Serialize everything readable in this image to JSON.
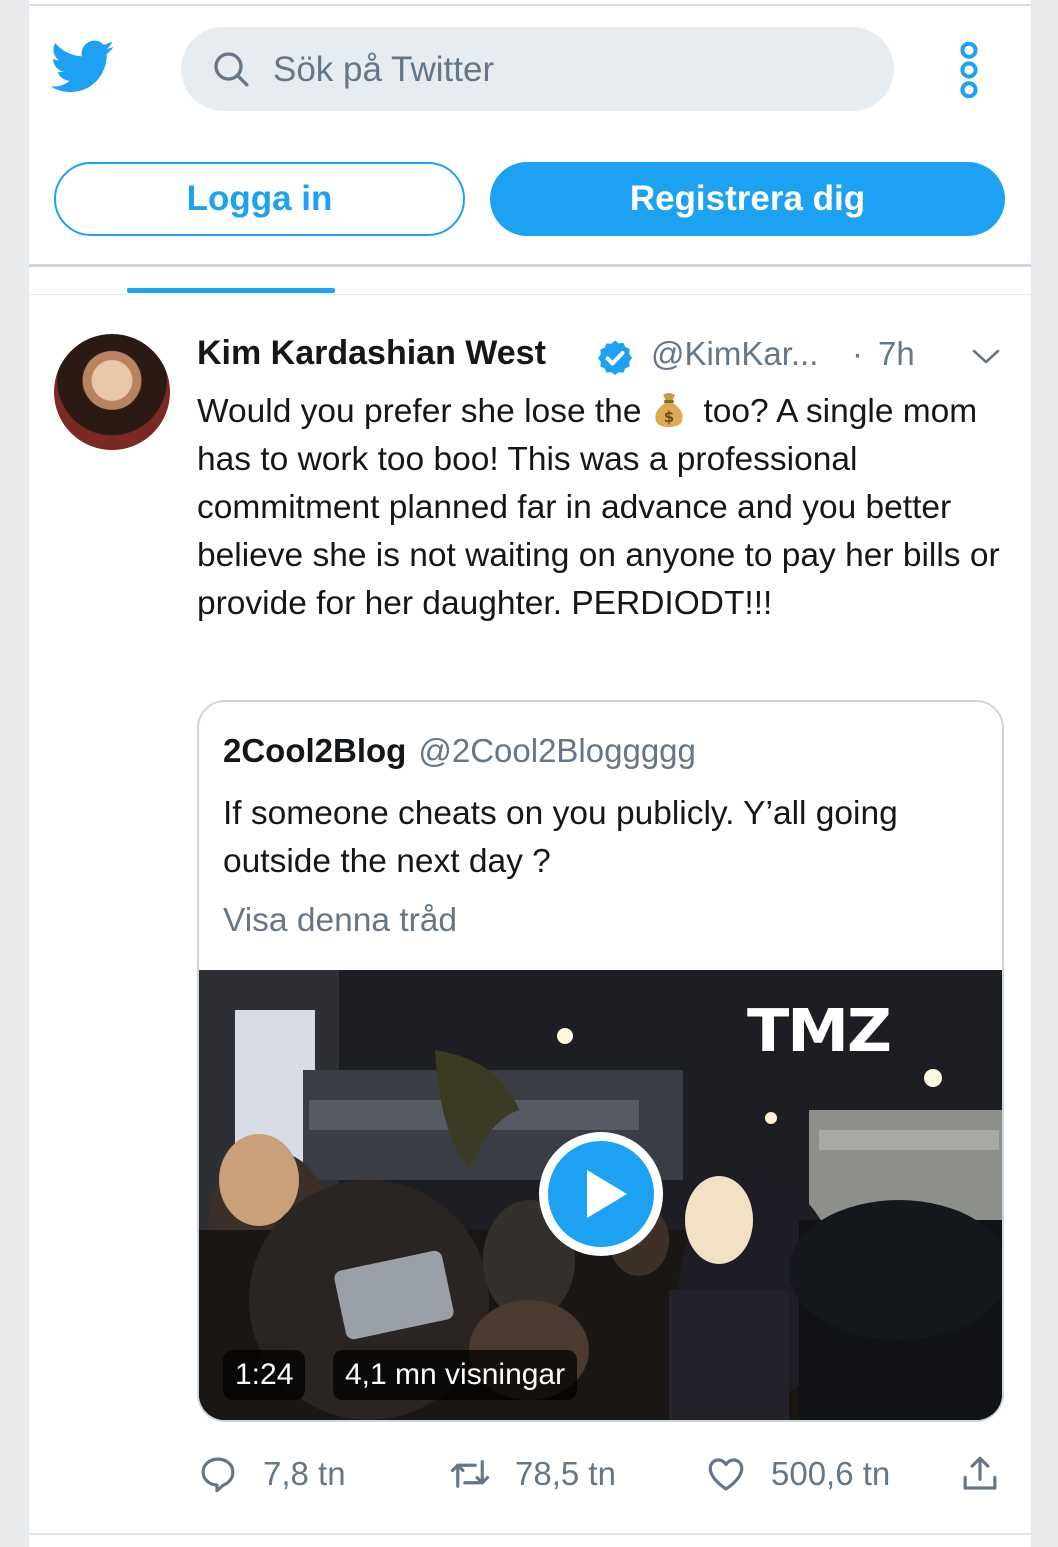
{
  "header": {
    "search_placeholder": "Sök på Twitter",
    "login_label": "Logga in",
    "signup_label": "Registrera dig",
    "icons": [
      "twitter-bird-icon",
      "search-icon",
      "more-vertical-icon"
    ]
  },
  "tweet": {
    "author_name": "Kim Kardashian West",
    "handle": "@KimKar...",
    "separator": "·",
    "time": "7h",
    "text_before_emoji": "Would you prefer she lose the",
    "text_after_emoji": "too? A single mom has to work too boo! This was a professional commitment planned far in advance and you better believe she is not waiting on anyone to pay her bills or provide for her daughter. PERDIODT!!!",
    "emoji": "money-bag-emoji",
    "quoted": {
      "author_name": "2Cool2Blog",
      "handle": "@2Cool2Bloggggg",
      "text": "If someone cheats on you publicly. Y’all going outside the next day ?",
      "thread_link": "Visa denna tråd",
      "video": {
        "watermark": "TMZ",
        "duration": "1:24",
        "views": "4,1 mn visningar"
      }
    },
    "stats": {
      "replies": "7,8 tn",
      "retweets": "78,5 tn",
      "likes": "500,6 tn"
    }
  },
  "colors": {
    "accent": "#1da1f2",
    "text": "#14171a",
    "secondary_text": "#657786",
    "border": "#ccd6dd"
  }
}
